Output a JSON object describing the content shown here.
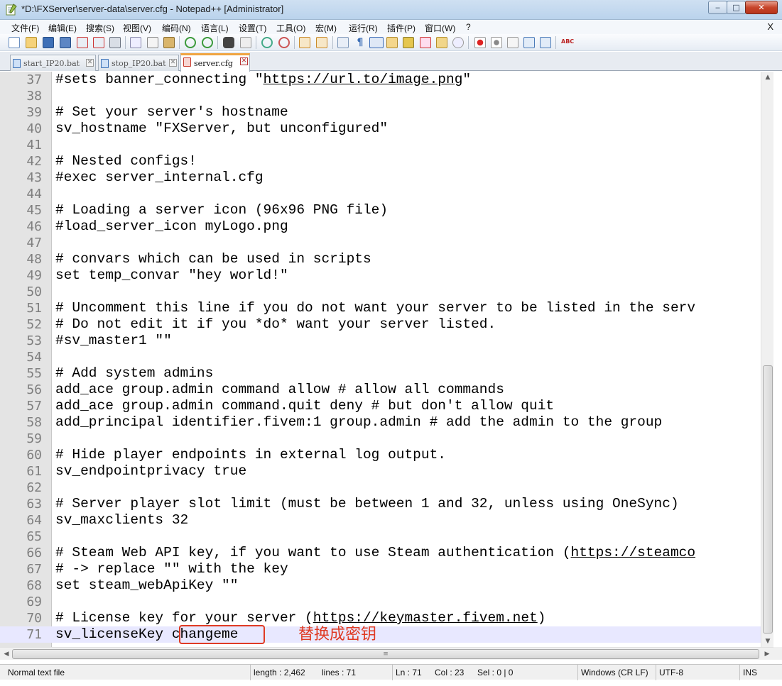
{
  "window": {
    "title": "*D:\\FXServer\\server-data\\server.cfg - Notepad++ [Administrator]",
    "minimize": "‒",
    "maximize": "□",
    "close": "✕"
  },
  "menu": {
    "items": [
      "文件(F)",
      "编辑(E)",
      "搜索(S)",
      "视图(V)",
      "编码(N)",
      "语言(L)",
      "设置(T)",
      "工具(O)",
      "宏(M)",
      "运行(R)",
      "插件(P)",
      "窗口(W)",
      "?"
    ],
    "close_doc": "X"
  },
  "tabs": [
    {
      "label": "start_IP20.bat",
      "close": "✕"
    },
    {
      "label": "stop_IP20.bat",
      "close": "✕"
    },
    {
      "label": "server.cfg",
      "close": "✕"
    }
  ],
  "editor": {
    "lines": [
      {
        "n": "37",
        "text": "#sets banner_connecting \"",
        "link": "https://url.to/image.png",
        "after": "\""
      },
      {
        "n": "38",
        "text": ""
      },
      {
        "n": "39",
        "text": "# Set your server's hostname"
      },
      {
        "n": "40",
        "text": "sv_hostname \"FXServer, but unconfigured\""
      },
      {
        "n": "41",
        "text": ""
      },
      {
        "n": "42",
        "text": "# Nested configs!"
      },
      {
        "n": "43",
        "text": "#exec server_internal.cfg"
      },
      {
        "n": "44",
        "text": ""
      },
      {
        "n": "45",
        "text": "# Loading a server icon (96x96 PNG file)"
      },
      {
        "n": "46",
        "text": "#load_server_icon myLogo.png"
      },
      {
        "n": "47",
        "text": ""
      },
      {
        "n": "48",
        "text": "# convars which can be used in scripts"
      },
      {
        "n": "49",
        "text": "set temp_convar \"hey world!\""
      },
      {
        "n": "50",
        "text": ""
      },
      {
        "n": "51",
        "text": "# Uncomment this line if you do not want your server to be listed in the serv"
      },
      {
        "n": "52",
        "text": "# Do not edit it if you *do* want your server listed."
      },
      {
        "n": "53",
        "text": "#sv_master1 \"\""
      },
      {
        "n": "54",
        "text": ""
      },
      {
        "n": "55",
        "text": "# Add system admins"
      },
      {
        "n": "56",
        "text": "add_ace group.admin command allow # allow all commands"
      },
      {
        "n": "57",
        "text": "add_ace group.admin command.quit deny # but don't allow quit"
      },
      {
        "n": "58",
        "text": "add_principal identifier.fivem:1 group.admin # add the admin to the group"
      },
      {
        "n": "59",
        "text": ""
      },
      {
        "n": "60",
        "text": "# Hide player endpoints in external log output."
      },
      {
        "n": "61",
        "text": "sv_endpointprivacy true"
      },
      {
        "n": "62",
        "text": ""
      },
      {
        "n": "63",
        "text": "# Server player slot limit (must be between 1 and 32, unless using OneSync)"
      },
      {
        "n": "64",
        "text": "sv_maxclients 32"
      },
      {
        "n": "65",
        "text": ""
      },
      {
        "n": "66",
        "text": "# Steam Web API key, if you want to use Steam authentication (",
        "link": "https://steamco"
      },
      {
        "n": "67",
        "text": "# -> replace \"\" with the key"
      },
      {
        "n": "68",
        "text": "set steam_webApiKey \"\""
      },
      {
        "n": "69",
        "text": ""
      },
      {
        "n": "70",
        "text": "# License key for your server (",
        "link": "https://keymaster.fivem.net",
        "after": ")"
      },
      {
        "n": "71",
        "text": "sv_licenseKey changeme"
      }
    ],
    "annotation": "替换成密钥"
  },
  "scroll": {
    "up": "▲",
    "down": "▼",
    "left": "◀",
    "right": "▶",
    "grip": "≡"
  },
  "status": {
    "file_type": "Normal text file",
    "length": "length : 2,462",
    "lines": "lines : 71",
    "ln": "Ln : 71",
    "col": "Col : 23",
    "sel": "Sel : 0 | 0",
    "eol": "Windows (CR LF)",
    "encoding": "UTF-8",
    "mode": "INS"
  },
  "colors": {
    "annotation": "#e03a24",
    "current_line": "#e8e8ff",
    "active_tab_accent": "#f0a441"
  }
}
